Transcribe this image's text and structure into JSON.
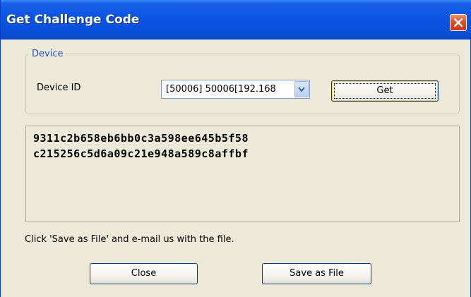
{
  "window": {
    "title": "Get Challenge Code"
  },
  "device_group": {
    "legend": "Device",
    "device_id_label": "Device ID",
    "device_select_value": "[50006] 50006[192.168",
    "get_label": "Get"
  },
  "challenge": {
    "lines": [
      "9311c2b658eb6bb0c3a598ee645b5f58",
      "c215256c5d6a09c21e948a589c8affbf"
    ]
  },
  "hint_text": "Click 'Save as File' and e-mail us with the file.",
  "buttons": {
    "close_label": "Close",
    "save_label": "Save as File"
  },
  "icons": {
    "close": "close-icon",
    "dropdown": "chevron-down-icon"
  },
  "colors": {
    "titlebar": "#0b54e2",
    "close_button": "#e2532a",
    "legend_text": "#1f4fc2",
    "dialog_bg": "#ece9d8"
  }
}
